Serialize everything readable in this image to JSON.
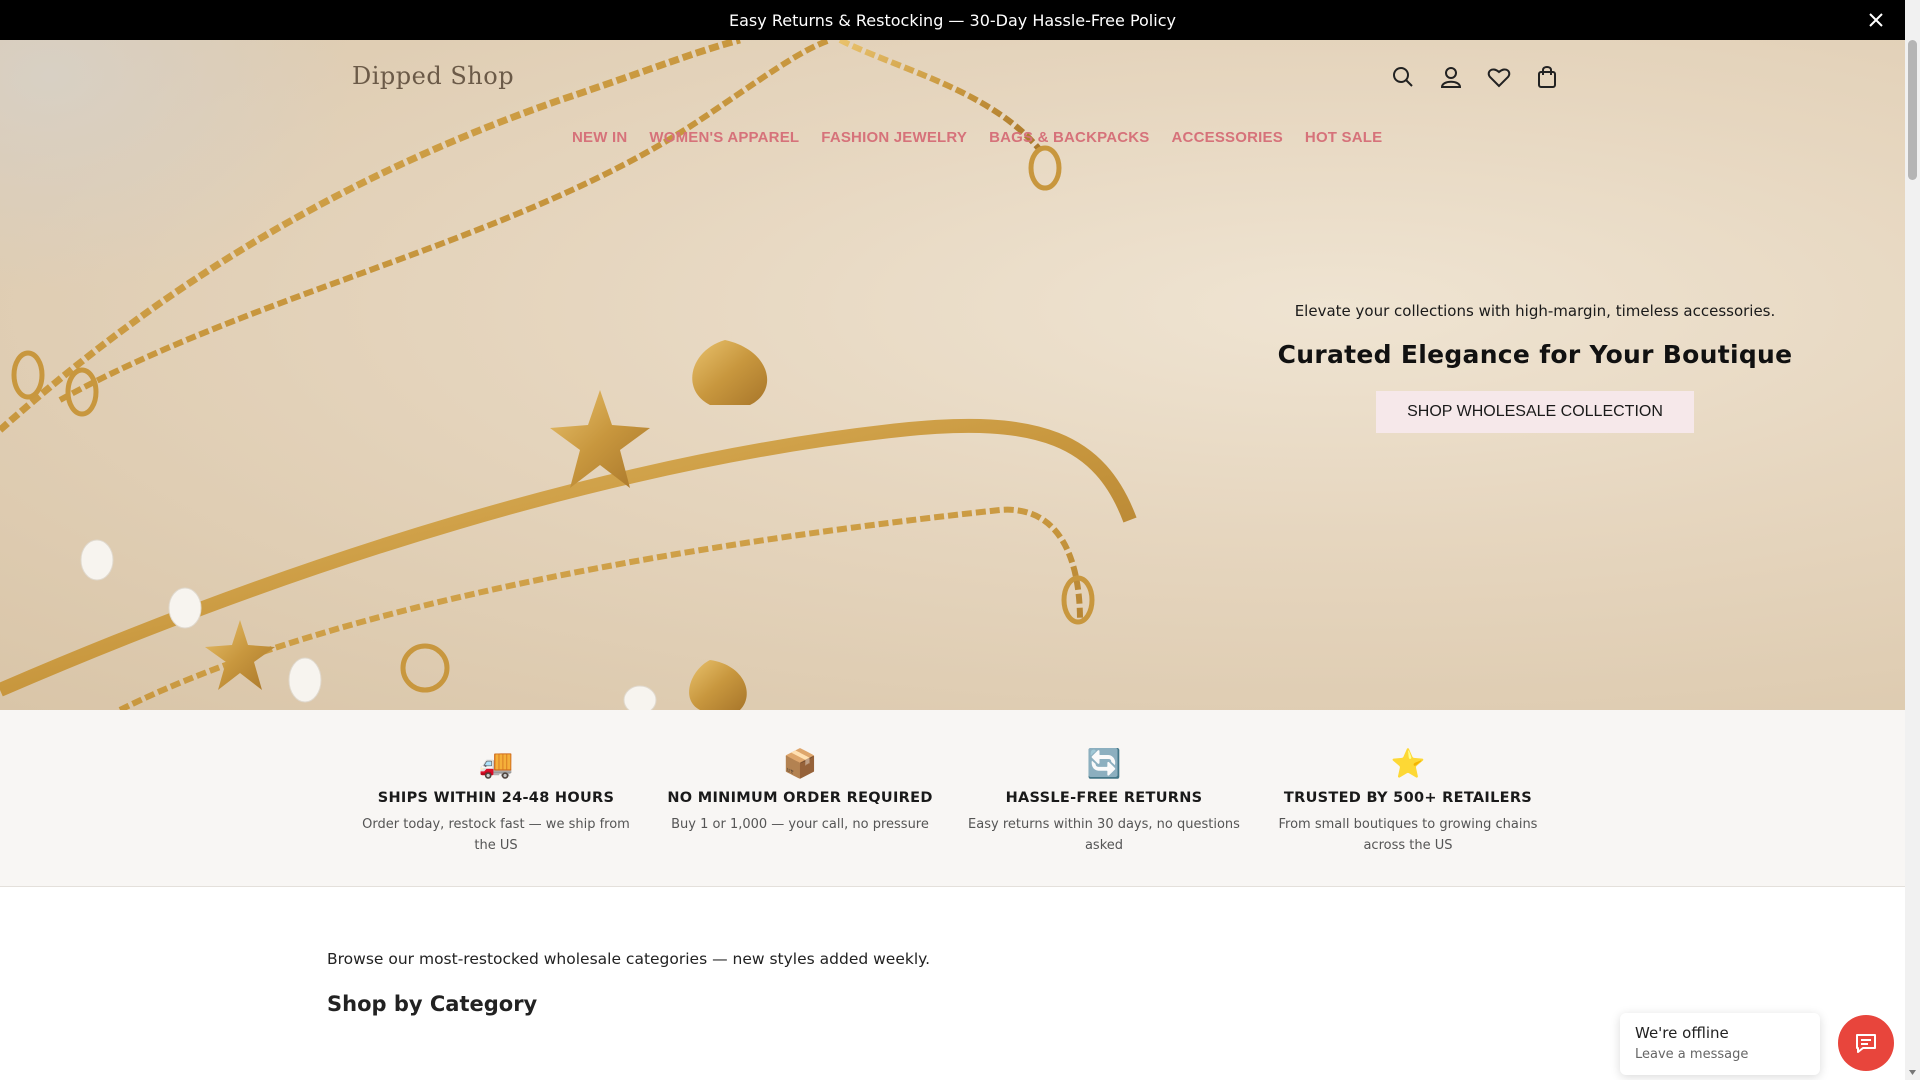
{
  "announcement": {
    "text": "Easy Returns & Restocking — 30-Day Hassle-Free Policy",
    "close_icon": "close-icon"
  },
  "header": {
    "logo": "Dipped Shop",
    "icons": [
      "search-icon",
      "account-icon",
      "wishlist-icon",
      "cart-icon"
    ]
  },
  "nav": {
    "items": [
      {
        "label": "NEW IN"
      },
      {
        "label": "WOMEN'S APPAREL"
      },
      {
        "label": "FASHION JEWELRY"
      },
      {
        "label": "BAGS & BACKPACKS"
      },
      {
        "label": "ACCESSORIES"
      },
      {
        "label": "HOT SALE"
      }
    ],
    "color": "#d6727a"
  },
  "hero": {
    "subtitle": "Elevate your collections with high-margin, timeless accessories.",
    "title": "Curated Elegance for Your Boutique",
    "cta": "SHOP WHOLESALE COLLECTION"
  },
  "features": [
    {
      "emoji": "🚚",
      "title": "SHIPS WITHIN 24-48 HOURS",
      "desc": "Order today, restock fast — we ship from the US"
    },
    {
      "emoji": "📦",
      "title": "NO MINIMUM ORDER REQUIRED",
      "desc": "Buy 1 or 1,000 — your call, no pressure"
    },
    {
      "emoji": "🔄",
      "title": "HASSLE-FREE RETURNS",
      "desc": "Easy returns within 30 days, no questions asked"
    },
    {
      "emoji": "⭐",
      "title": "TRUSTED BY 500+ RETAILERS",
      "desc": "From small boutiques to growing chains across the US"
    }
  ],
  "categories": {
    "intro": "Browse our most-restocked wholesale categories — new styles added weekly.",
    "title": "Shop by Category"
  },
  "chat": {
    "status": "We're offline",
    "message": "Leave a message",
    "accent": "#e8453c"
  }
}
